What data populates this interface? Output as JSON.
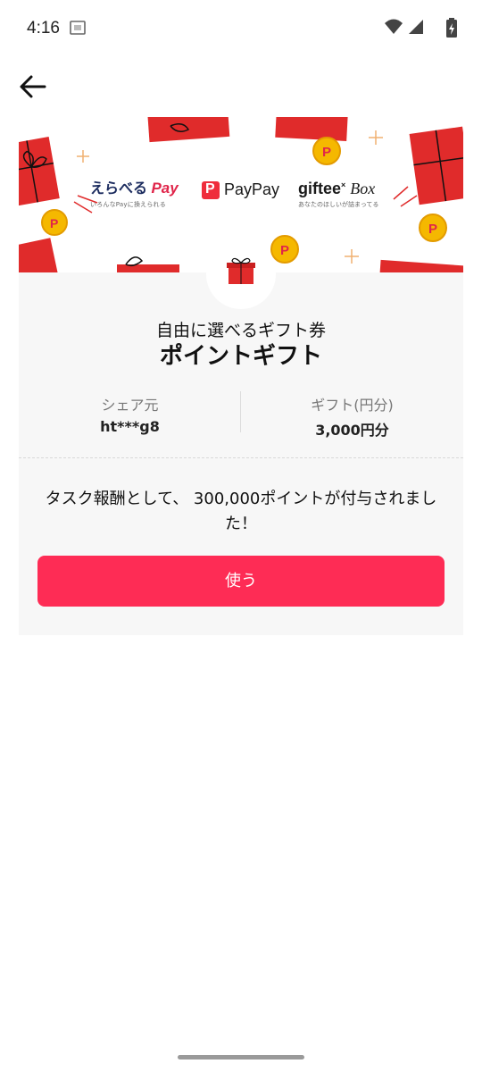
{
  "status_bar": {
    "time": "4:16"
  },
  "banner": {
    "brands": {
      "erabe_pay": {
        "name_main": "えらべる",
        "name_pay": "Pay",
        "tagline": "いろんなPayに換えられる"
      },
      "paypay": {
        "logo_letter": "P",
        "name": "PayPay"
      },
      "giftee_box": {
        "name_main": "giftee",
        "name_box": "Box",
        "tagline": "あなたのほしいが詰まってる"
      }
    }
  },
  "card": {
    "subtitle": "自由に選べるギフト券",
    "title": "ポイントギフト",
    "sender": {
      "label": "シェア元",
      "value": "ht***g8"
    },
    "gift_amount": {
      "label": "ギフト(円分)",
      "value": "3,000円分"
    },
    "message": "タスク報酬として、 300,000ポイントが付与されました！",
    "use_button_label": "使う"
  },
  "colors": {
    "accent": "#fe2c55",
    "gift_red": "#e02b2b",
    "coin_gold": "#f5b800",
    "card_bg": "#f7f7f7"
  },
  "icons": {
    "back": "arrow-left-icon",
    "gift": "gift-box-icon"
  }
}
